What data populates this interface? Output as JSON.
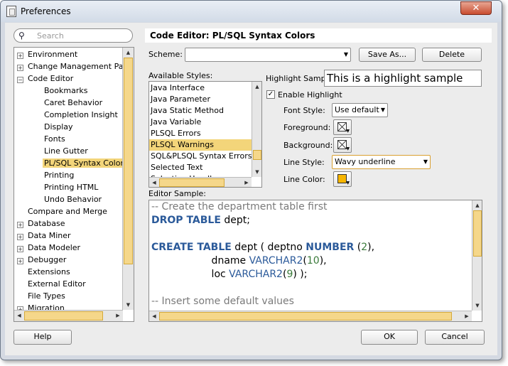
{
  "window": {
    "title": "Preferences",
    "close_glyph": "✕"
  },
  "search": {
    "placeholder": "Search",
    "value": ""
  },
  "tree": [
    {
      "label": "Environment",
      "level": 0,
      "expander": "+"
    },
    {
      "label": "Change Management Parar",
      "level": 0,
      "expander": "+"
    },
    {
      "label": "Code Editor",
      "level": 0,
      "expander": "−"
    },
    {
      "label": "Bookmarks",
      "level": 1
    },
    {
      "label": "Caret Behavior",
      "level": 1
    },
    {
      "label": "Completion Insight",
      "level": 1
    },
    {
      "label": "Display",
      "level": 1
    },
    {
      "label": "Fonts",
      "level": 1
    },
    {
      "label": "Line Gutter",
      "level": 1
    },
    {
      "label": "PL/SQL Syntax Colors",
      "level": 1,
      "selected": true
    },
    {
      "label": "Printing",
      "level": 1
    },
    {
      "label": "Printing HTML",
      "level": 1
    },
    {
      "label": "Undo Behavior",
      "level": 1
    },
    {
      "label": "Compare and Merge",
      "level": 0
    },
    {
      "label": "Database",
      "level": 0,
      "expander": "+"
    },
    {
      "label": "Data Miner",
      "level": 0,
      "expander": "+"
    },
    {
      "label": "Data Modeler",
      "level": 0,
      "expander": "+"
    },
    {
      "label": "Debugger",
      "level": 0,
      "expander": "+"
    },
    {
      "label": "Extensions",
      "level": 0
    },
    {
      "label": "External Editor",
      "level": 0
    },
    {
      "label": "File Types",
      "level": 0
    },
    {
      "label": "Migration",
      "level": 0,
      "expander": "+"
    }
  ],
  "panel": {
    "heading": "Code Editor: PL/SQL Syntax Colors"
  },
  "scheme": {
    "label": "Scheme:",
    "value": "",
    "save_as": "Save As...",
    "delete": "Delete"
  },
  "styles": {
    "label": "Available Styles:",
    "items": [
      "Java Interface",
      "Java Parameter",
      "Java Static Method",
      "Java Variable",
      "PLSQL Errors",
      "PLSQL Warnings",
      "SQL&PLSQL Syntax Errors",
      "Selected Text",
      "Selection Handles"
    ],
    "selected_index": 5
  },
  "highlight": {
    "sample_label": "Highlight Sample:",
    "sample_text": "This is a highlight sample",
    "enable_label": "Enable Highlight",
    "enabled": true,
    "font_style_label": "Font Style:",
    "font_style_value": "Use default",
    "foreground_label": "Foreground:",
    "background_label": "Background:",
    "line_style_label": "Line Style:",
    "line_style_value": "Wavy underline",
    "line_color_label": "Line Color:",
    "line_color": "#f7b500"
  },
  "editor_sample": {
    "label": "Editor Sample:",
    "lines": [
      [
        {
          "t": "-- Create the department table first",
          "c": "cm"
        }
      ],
      [
        {
          "t": "DROP TABLE",
          "c": "kw"
        },
        {
          "t": " dept;",
          "c": ""
        }
      ],
      [
        {
          "t": "",
          "c": ""
        }
      ],
      [
        {
          "t": "CREATE TABLE",
          "c": "kw"
        },
        {
          "t": " dept ( deptno ",
          "c": ""
        },
        {
          "t": "NUMBER",
          "c": "kw"
        },
        {
          "t": " (",
          "c": ""
        },
        {
          "t": "2",
          "c": "num"
        },
        {
          "t": "),",
          "c": ""
        }
      ],
      [
        {
          "t": "                   dname ",
          "c": ""
        },
        {
          "t": "VARCHAR2",
          "c": "ty"
        },
        {
          "t": "(",
          "c": ""
        },
        {
          "t": "10",
          "c": "num"
        },
        {
          "t": "),",
          "c": ""
        }
      ],
      [
        {
          "t": "                   loc ",
          "c": ""
        },
        {
          "t": "VARCHAR2",
          "c": "ty"
        },
        {
          "t": "(",
          "c": ""
        },
        {
          "t": "9",
          "c": "num"
        },
        {
          "t": ") );",
          "c": ""
        }
      ],
      [
        {
          "t": "",
          "c": ""
        }
      ],
      [
        {
          "t": "-- Insert some default values",
          "c": "cm"
        }
      ]
    ]
  },
  "footer": {
    "help": "Help",
    "ok": "OK",
    "cancel": "Cancel"
  },
  "colors": {
    "selection": "#f3d57a",
    "scroll_thumb": "#f5d78a",
    "keyword": "#2b5a9a"
  }
}
